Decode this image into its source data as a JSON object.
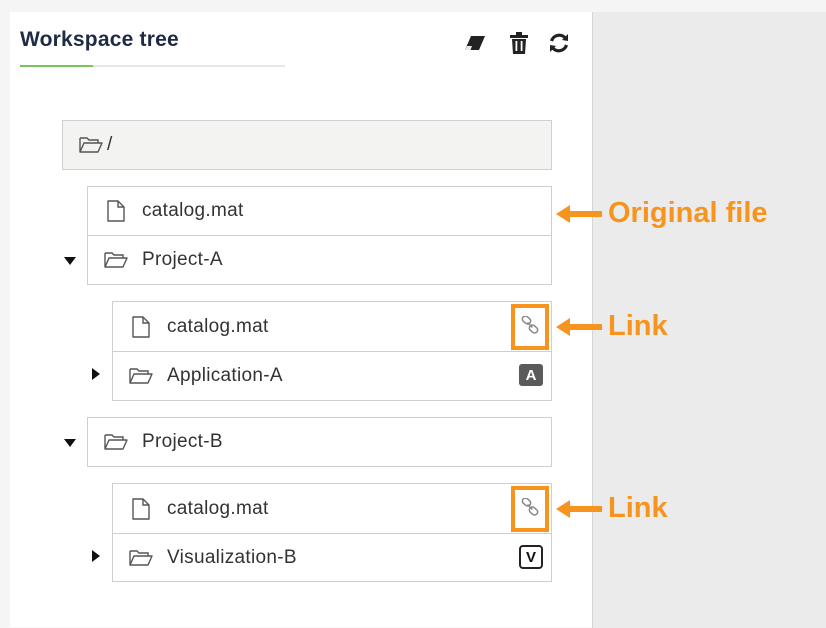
{
  "panel": {
    "title": "Workspace tree",
    "tools": [
      {
        "name": "eraser-icon"
      },
      {
        "name": "trash-icon"
      },
      {
        "name": "refresh-icon"
      }
    ]
  },
  "tree": {
    "root_label": "/",
    "root_files": [
      {
        "label": "catalog.mat"
      }
    ],
    "projects": [
      {
        "label": "Project-A",
        "expanded": true,
        "children": [
          {
            "label": "catalog.mat",
            "type": "file",
            "link": true
          },
          {
            "label": "Application-A",
            "type": "folder",
            "collapsed": true,
            "badge": "A"
          }
        ]
      },
      {
        "label": "Project-B",
        "expanded": true,
        "children": [
          {
            "label": "catalog.mat",
            "type": "file",
            "link": true
          },
          {
            "label": "Visualization-B",
            "type": "folder",
            "collapsed": true,
            "badge": "V"
          }
        ]
      }
    ]
  },
  "annotations": {
    "original_file": "Original file",
    "link_1": "Link",
    "link_2": "Link"
  },
  "colors": {
    "accent_green": "#7cc35a",
    "annotation_orange": "#f7941d",
    "title_navy": "#1f2a44"
  }
}
